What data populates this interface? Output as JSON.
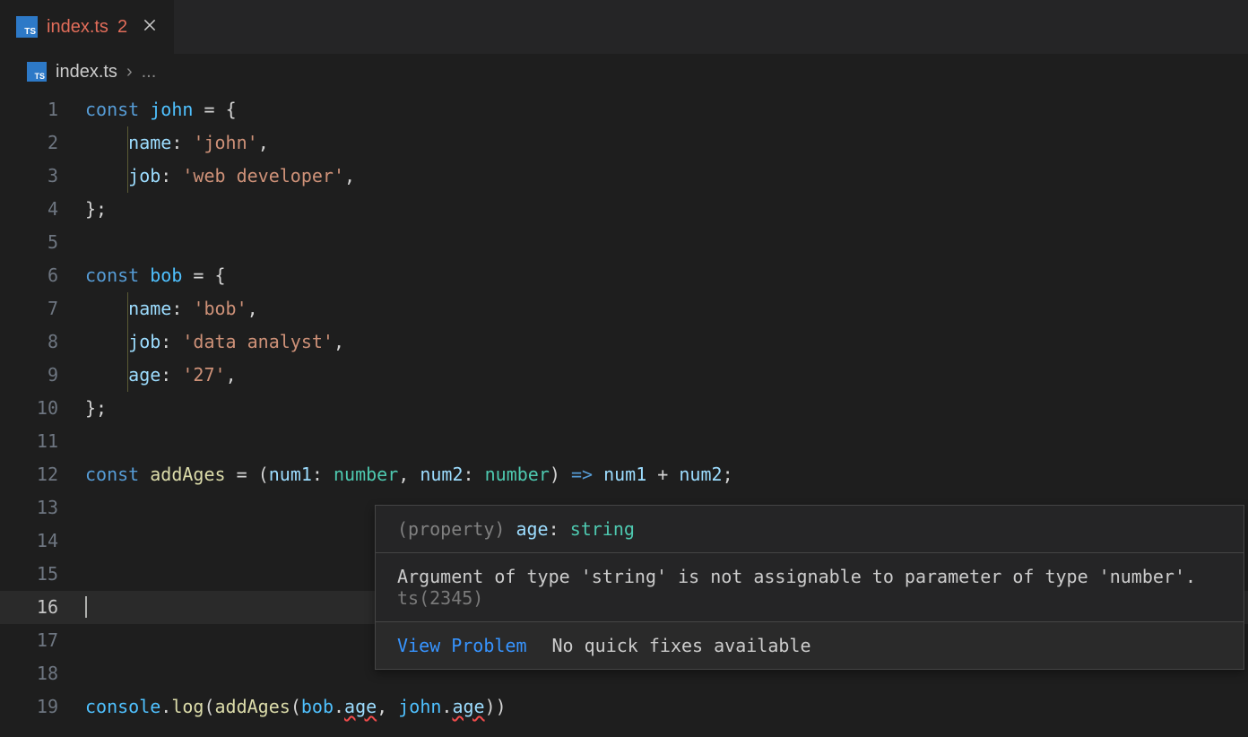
{
  "tab": {
    "icon_label": "TS",
    "filename": "index.ts",
    "error_count": "2"
  },
  "breadcrumb": {
    "icon_label": "TS",
    "filename": "index.ts",
    "sep": "›",
    "ellipsis": "..."
  },
  "code": {
    "l1": {
      "kw": "const",
      "var": "john",
      "eq": " = ",
      "brace": "{"
    },
    "l2": {
      "prop": "name",
      "col": ":",
      "str": "'john'",
      "comma": ","
    },
    "l3": {
      "prop": "job",
      "col": ":",
      "str": "'web developer'",
      "comma": ","
    },
    "l4": {
      "close": "};"
    },
    "l6": {
      "kw": "const",
      "var": "bob",
      "eq": " = ",
      "brace": "{"
    },
    "l7": {
      "prop": "name",
      "col": ":",
      "str": "'bob'",
      "comma": ","
    },
    "l8": {
      "prop": "job",
      "col": ":",
      "str": "'data analyst'",
      "comma": ","
    },
    "l9": {
      "prop": "age",
      "col": ":",
      "str": "'27'",
      "comma": ","
    },
    "l10": {
      "close": "};"
    },
    "l12": {
      "kw": "const",
      "fn": "addAges",
      "eq": " = ",
      "p1": "num1",
      "t1": "number",
      "p2": "num2",
      "t2": "number",
      "arrow": "=>",
      "expr1": "num1",
      "plus": " + ",
      "expr2": "num2",
      "semi": ";"
    },
    "l19": {
      "obj": "console",
      "dot": ".",
      "log": "log",
      "fn": "addAges",
      "a1o": "bob",
      "a1p": "age",
      "a2o": "john",
      "a2p": "age"
    }
  },
  "hover": {
    "sig_paren": "(",
    "sig_kind": "property",
    "sig_paren2": ")",
    "sig_name": " age",
    "sig_colon": ": ",
    "sig_type": "string",
    "msg": "Argument of type 'string' is not assignable to parameter of type 'number'.",
    "code": "ts(2345)",
    "view": "View Problem",
    "nofix": "No quick fixes available"
  },
  "line_numbers": [
    "1",
    "2",
    "3",
    "4",
    "5",
    "6",
    "7",
    "8",
    "9",
    "10",
    "11",
    "12",
    "13",
    "14",
    "15",
    "16",
    "17",
    "18",
    "19"
  ]
}
